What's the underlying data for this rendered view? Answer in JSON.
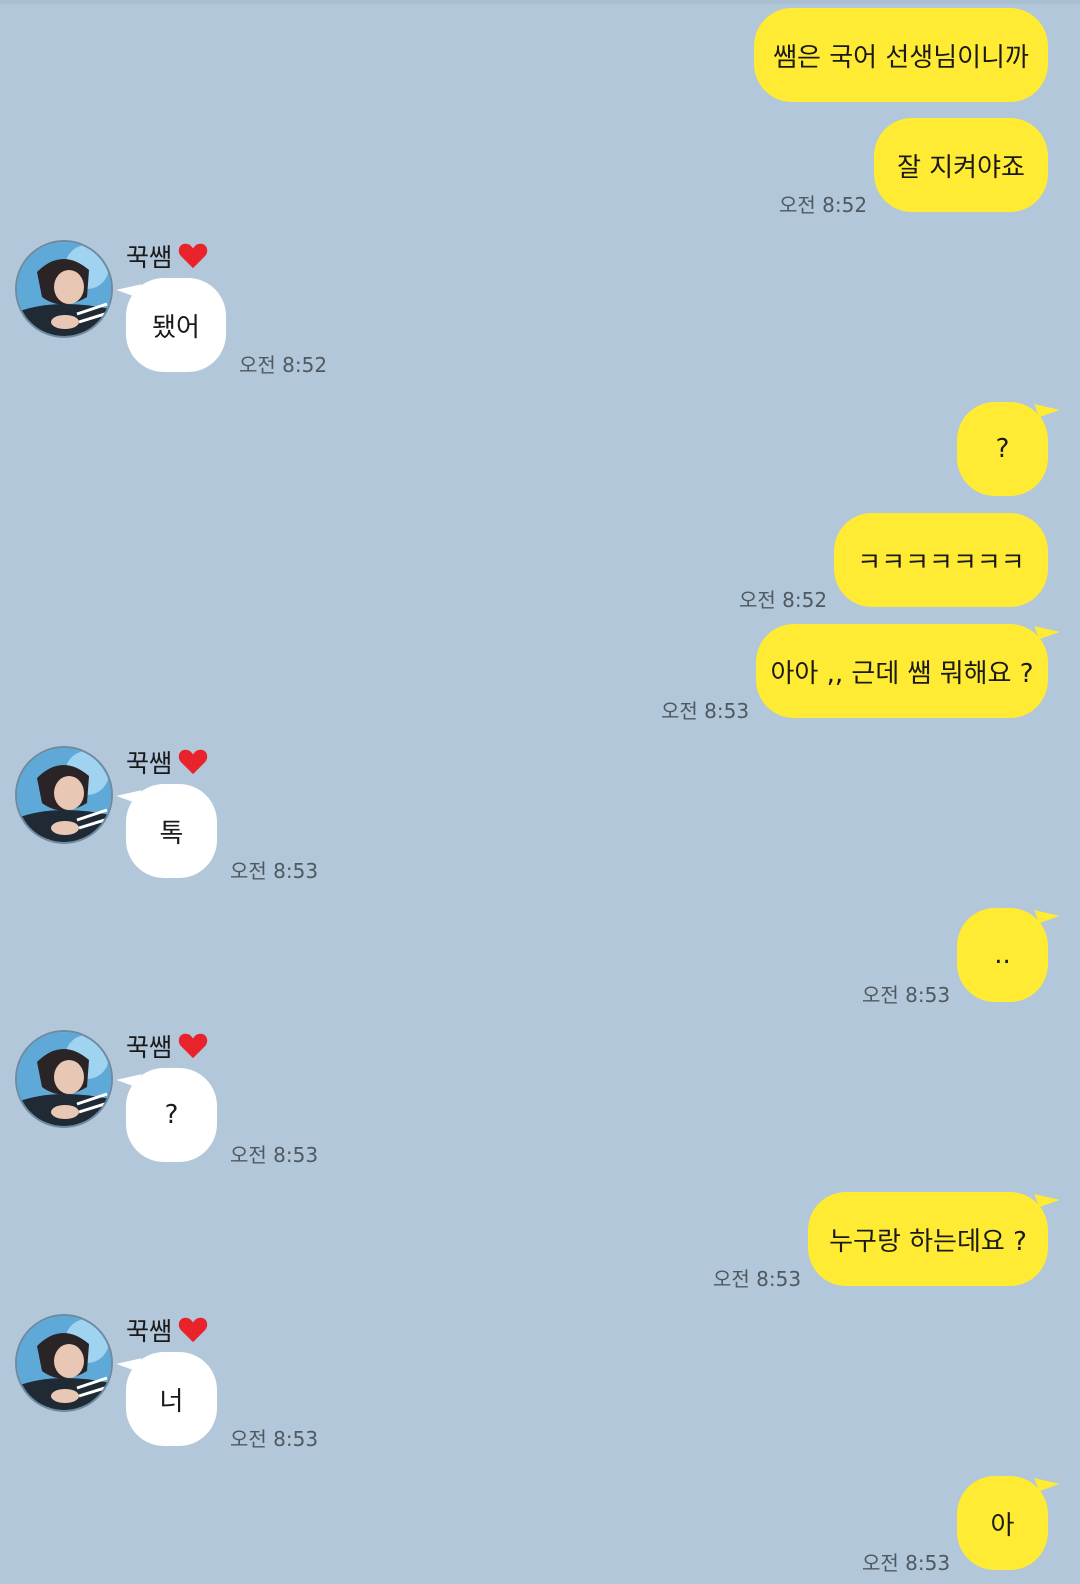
{
  "contact": {
    "name": "꾹쌤",
    "heart": "❤"
  },
  "messages": [
    {
      "from": "me",
      "text": "쌤은 국어 선생님이니까",
      "time": ""
    },
    {
      "from": "me",
      "text": "잘 지켜야죠",
      "time": "오전 8:52"
    },
    {
      "from": "them",
      "text": "됐어",
      "time": "오전 8:52"
    },
    {
      "from": "me",
      "text": "?",
      "time": ""
    },
    {
      "from": "me",
      "text": "ㅋㅋㅋㅋㅋㅋㅋ",
      "time": "오전 8:52"
    },
    {
      "from": "me",
      "text": "아아 ,, 근데 쌤 뭐해요 ?",
      "time": "오전 8:53"
    },
    {
      "from": "them",
      "text": "톡",
      "time": "오전 8:53"
    },
    {
      "from": "me",
      "text": "..",
      "time": "오전 8:53"
    },
    {
      "from": "them",
      "text": "?",
      "time": "오전 8:53"
    },
    {
      "from": "me",
      "text": "누구랑 하는데요 ?",
      "time": "오전 8:53"
    },
    {
      "from": "them",
      "text": "너",
      "time": "오전 8:53"
    },
    {
      "from": "me",
      "text": "아",
      "time": "오전 8:53"
    }
  ],
  "colors": {
    "background": "#b2c7d9",
    "my_bubble": "#ffeb33",
    "their_bubble": "#ffffff"
  }
}
